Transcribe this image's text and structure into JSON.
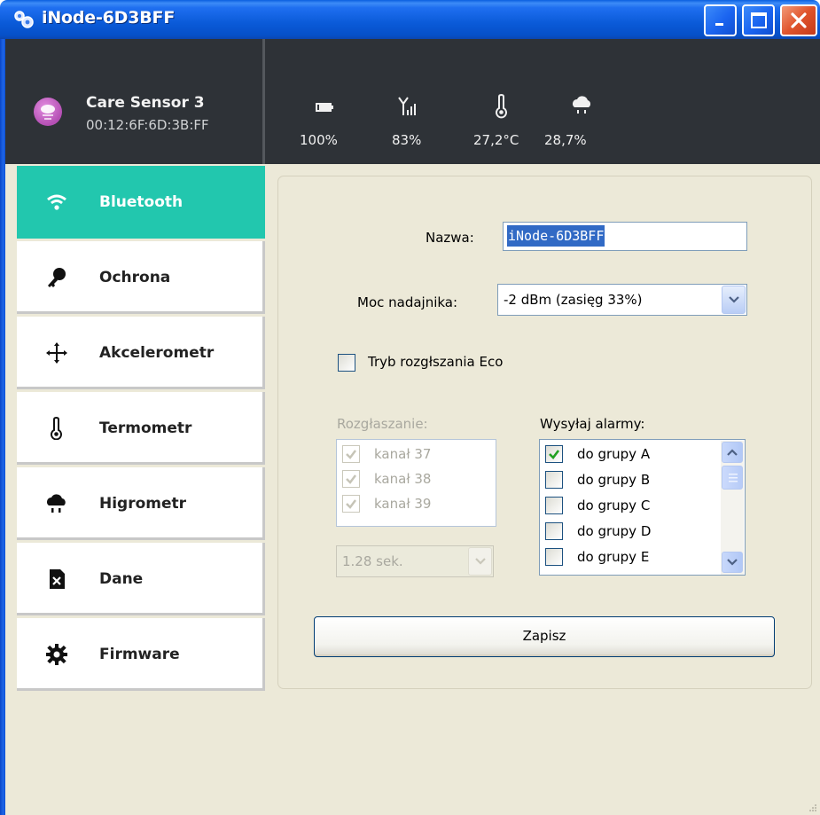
{
  "window": {
    "title": "iNode-6D3BFF",
    "accent_color": "#0a5ad8"
  },
  "device": {
    "name": "Care Sensor 3",
    "mac": "00:12:6F:6D:3B:FF",
    "icon": "cloud-sensor-icon"
  },
  "stats": [
    {
      "icon": "battery-icon",
      "value": "100%"
    },
    {
      "icon": "signal-icon",
      "value": "83%"
    },
    {
      "icon": "thermometer-icon",
      "value": "27,2°C"
    },
    {
      "icon": "rain-cloud-icon",
      "value": "28,7%"
    }
  ],
  "sidebar": {
    "active_color": "#22c7ae",
    "items": [
      {
        "label": "Bluetooth",
        "icon": "wifi-icon",
        "active": true
      },
      {
        "label": "Ochrona",
        "icon": "key-icon",
        "active": false
      },
      {
        "label": "Akcelerometr",
        "icon": "move-arrows-icon",
        "active": false
      },
      {
        "label": "Termometr",
        "icon": "thermometer-icon",
        "active": false
      },
      {
        "label": "Higrometr",
        "icon": "rain-cloud-icon",
        "active": false
      },
      {
        "label": "Dane",
        "icon": "data-file-icon",
        "active": false
      },
      {
        "label": "Firmware",
        "icon": "gear-icon",
        "active": false
      }
    ]
  },
  "form": {
    "name_label": "Nazwa:",
    "name_value": "iNode-6D3BFF",
    "power_label": "Moc nadajnika:",
    "power_value": "-2 dBm  (zasięg 33%)",
    "eco_label": "Tryb rozgłszania Eco",
    "eco_checked": false,
    "broadcast_label": "Rozgłaszanie:",
    "channels": [
      {
        "label": "kanał 37",
        "checked": true
      },
      {
        "label": "kanał 38",
        "checked": true
      },
      {
        "label": "kanał 39",
        "checked": true
      }
    ],
    "interval_value": "1.28 sek.",
    "alarms_label": "Wysyłaj alarmy:",
    "alarm_groups": [
      {
        "label": "do grupy A",
        "checked": true
      },
      {
        "label": "do grupy B",
        "checked": false
      },
      {
        "label": "do grupy C",
        "checked": false
      },
      {
        "label": "do grupy D",
        "checked": false
      },
      {
        "label": "do grupy E",
        "checked": false
      }
    ],
    "save_label": "Zapisz"
  }
}
